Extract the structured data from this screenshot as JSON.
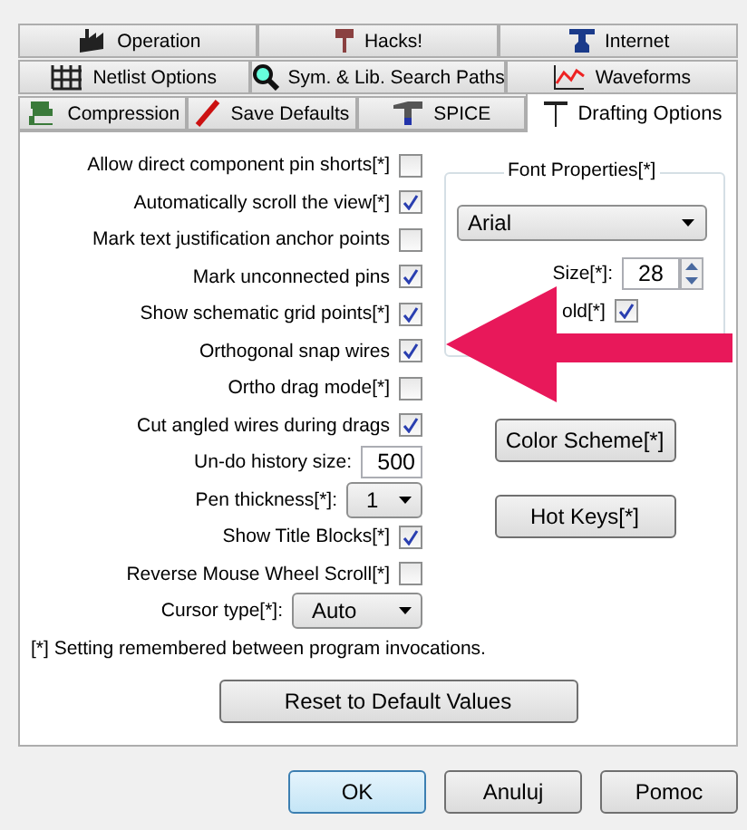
{
  "tab_rows": [
    [
      {
        "label": "Operation",
        "selected": false
      },
      {
        "label": "Hacks!",
        "selected": false
      },
      {
        "label": "Internet",
        "selected": false
      }
    ],
    [
      {
        "label": "Netlist Options",
        "selected": false
      },
      {
        "label": "Sym. & Lib. Search Paths",
        "selected": false
      },
      {
        "label": "Waveforms",
        "selected": false
      }
    ],
    [
      {
        "label": "Compression",
        "selected": false
      },
      {
        "label": "Save Defaults",
        "selected": false
      },
      {
        "label": "SPICE",
        "selected": false
      },
      {
        "label": "Drafting Options",
        "selected": true
      }
    ]
  ],
  "options": [
    {
      "kind": "checkbox",
      "label": "Allow direct component pin shorts[*]",
      "checked": false
    },
    {
      "kind": "checkbox",
      "label": "Automatically scroll the view[*]",
      "checked": true
    },
    {
      "kind": "checkbox",
      "label": "Mark text justification anchor points",
      "checked": false
    },
    {
      "kind": "checkbox",
      "label": "Mark unconnected pins",
      "checked": true
    },
    {
      "kind": "checkbox",
      "label": "Show schematic grid points[*]",
      "checked": true
    },
    {
      "kind": "checkbox",
      "label": "Orthogonal snap wires",
      "checked": true
    },
    {
      "kind": "checkbox",
      "label": "Ortho drag mode[*]",
      "checked": false
    },
    {
      "kind": "checkbox",
      "label": "Cut angled wires during drags",
      "checked": true
    },
    {
      "kind": "number",
      "label": "Un-do history size:",
      "value": "500"
    },
    {
      "kind": "select",
      "label": "Pen thickness[*]:",
      "value": "1"
    },
    {
      "kind": "checkbox",
      "label": "Show Title Blocks[*]",
      "checked": true
    },
    {
      "kind": "checkbox",
      "label": "Reverse Mouse Wheel Scroll[*]",
      "checked": false
    },
    {
      "kind": "select",
      "label": "Cursor type[*]:",
      "value": "Auto"
    }
  ],
  "note": "[*] Setting remembered between program invocations.",
  "reset_button": "Reset to Default Values",
  "font_group": {
    "title": "Font Properties[*]",
    "font": "Arial",
    "size_label": "Size[*]:",
    "size": "28",
    "bold_label": "old[*]",
    "bold_checked": true
  },
  "side_buttons": [
    "Color Scheme[*]",
    "Hot Keys[*]"
  ],
  "dialog_buttons": [
    {
      "label": "OK",
      "default": true
    },
    {
      "label": "Anuluj",
      "default": false
    },
    {
      "label": "Pomoc",
      "default": false
    }
  ]
}
